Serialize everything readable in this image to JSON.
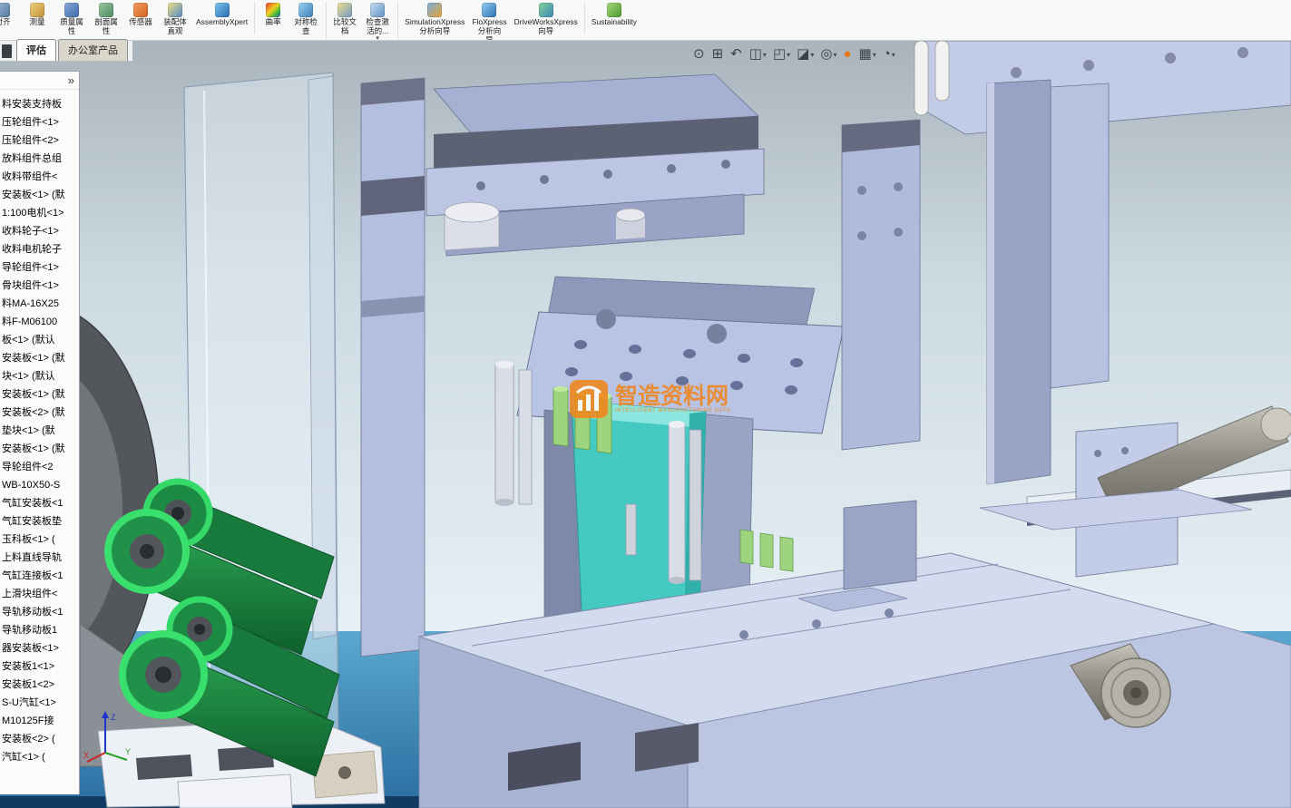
{
  "ribbon": {
    "tools": [
      {
        "label": "对齐",
        "icon_name": "align-icon",
        "icon_style": "background:linear-gradient(135deg,#9ab6d4,#54789c)"
      },
      {
        "label": "测量",
        "icon_name": "measure-icon",
        "icon_style": "background:linear-gradient(135deg,#f0d080,#c09038)"
      },
      {
        "label": "质量属\n性",
        "icon_name": "mass-properties-icon",
        "icon_style": "background:linear-gradient(135deg,#88aad8,#3c68a8)"
      },
      {
        "label": "剖面属\n性",
        "icon_name": "section-properties-icon",
        "icon_style": "background:linear-gradient(135deg,#9cc8a0,#4a8860)"
      },
      {
        "label": "传感器",
        "icon_name": "sensor-icon",
        "icon_style": "background:linear-gradient(135deg,#f0a060,#d06020)"
      },
      {
        "label": "装配体\n直观",
        "icon_name": "assembly-visualization-icon",
        "icon_style": "background:linear-gradient(135deg,#f0e080,#5088c8)"
      },
      {
        "label": "AssemblyXpert",
        "icon_name": "assemblyxpert-icon",
        "icon_style": "background:linear-gradient(135deg,#80c8f0,#2868b0)"
      },
      {
        "label": "曲率",
        "group_start": "1",
        "icon_name": "curvature-icon",
        "icon_style": "background:linear-gradient(135deg,#e03838,#f0d020 45%,#38b838 75%,#3858d8)"
      },
      {
        "label": "对称检\n查",
        "icon_name": "symmetry-check-icon",
        "icon_style": "background:linear-gradient(135deg,#a0d0f0,#3880b8)"
      },
      {
        "label": "比较文\n档",
        "group_start": "1",
        "icon_name": "compare-documents-icon",
        "icon_style": "background:linear-gradient(135deg,#f0e090,#7098c0)"
      },
      {
        "label": "检查激\n活的...",
        "dropdown": "▾",
        "icon_name": "check-active-document-icon",
        "icon_style": "background:linear-gradient(135deg,#c8dff0,#6090c0)"
      },
      {
        "label": "SimulationXpress\n分析向导",
        "group_start": "1",
        "icon_name": "simulationxpress-icon",
        "icon_style": "background:linear-gradient(135deg,#78b0e0,#e8a030)"
      },
      {
        "label": "FloXpress\n分析向\n导",
        "icon_name": "floxpress-icon",
        "icon_style": "background:linear-gradient(135deg,#90d0f0,#3070b0)"
      },
      {
        "label": "DriveWorksXpress\n向导",
        "icon_name": "driveworksxpress-icon",
        "icon_style": "background:linear-gradient(135deg,#88d098,#3888b8)"
      },
      {
        "label": "Sustainability",
        "group_start": "1",
        "icon_name": "sustainability-icon",
        "icon_style": "background:linear-gradient(135deg,#a8d878,#48982f)"
      }
    ]
  },
  "tabs": {
    "items": [
      {
        "label": "评估",
        "state": "active"
      },
      {
        "label": "办公室产品",
        "state": "normal"
      }
    ]
  },
  "feature_tree": {
    "collapse_glyph": "»",
    "items": [
      {
        "label": "料安装支持板"
      },
      {
        "label": "压轮组件<1>"
      },
      {
        "label": "压轮组件<2>"
      },
      {
        "label": "放料组件总组"
      },
      {
        "label": "收料带组件<"
      },
      {
        "label": "安装板<1> (默"
      },
      {
        "label": "1:100电机<1>"
      },
      {
        "label": "收料轮子<1>"
      },
      {
        "label": "收料电机轮子"
      },
      {
        "label": "导轮组件<1>"
      },
      {
        "label": "骨块组件<1>"
      },
      {
        "label": "料MA-16X25"
      },
      {
        "label": "料F-M06100"
      },
      {
        "label": "板<1> (默认"
      },
      {
        "label": "安装板<1> (默"
      },
      {
        "label": "块<1> (默认"
      },
      {
        "label": "安装板<1> (默"
      },
      {
        "label": "安装板<2> (默"
      },
      {
        "label": "垫块<1> (默"
      },
      {
        "label": "安装板<1> (默"
      },
      {
        "label": "导轮组件<2"
      },
      {
        "label": "WB-10X50-S"
      },
      {
        "label": "气缸安装板<1"
      },
      {
        "label": "气缸安装板垫"
      },
      {
        "label": "玉科板<1> ("
      },
      {
        "label": "上料直线导轨"
      },
      {
        "label": "气缸连接板<1"
      },
      {
        "label": "上滑块组件<"
      },
      {
        "label": "导轨移动板<1"
      },
      {
        "label": "导轨移动板1"
      },
      {
        "label": "器安装板<1>"
      },
      {
        "label": "安装板1<1>"
      },
      {
        "label": "安装板1<2>"
      },
      {
        "label": "S-U汽缸<1>"
      },
      {
        "label": "M10125F接"
      },
      {
        "label": "安装板<2> ("
      },
      {
        "label": "汽缸<1> ("
      }
    ]
  },
  "viewport_toolbar": {
    "buttons": [
      {
        "name": "zoom-fit-button",
        "icon": "zoom-fit-icon",
        "glyph": "⊙",
        "dropdown": ""
      },
      {
        "name": "zoom-area-button",
        "icon": "zoom-area-icon",
        "glyph": "⊞",
        "dropdown": ""
      },
      {
        "name": "previous-view-button",
        "icon": "previous-view-icon",
        "glyph": "↶",
        "dropdown": ""
      },
      {
        "name": "section-view-button",
        "icon": "section-view-icon",
        "glyph": "◫",
        "dropdown": "▾"
      },
      {
        "name": "view-orientation-button",
        "icon": "view-orientation-cube-icon",
        "glyph": "◰",
        "dropdown": "▾"
      },
      {
        "name": "display-style-button",
        "icon": "display-style-icon",
        "glyph": "◪",
        "dropdown": "▾"
      },
      {
        "name": "hide-show-items-button",
        "icon": "hide-show-items-icon",
        "glyph": "◎",
        "dropdown": "▾"
      },
      {
        "name": "edit-appearance-button",
        "icon": "edit-appearance-ball-icon",
        "glyph": "●",
        "style": "color:#e07818",
        "dropdown": ""
      },
      {
        "name": "apply-scene-button",
        "icon": "apply-scene-icon",
        "glyph": "▦",
        "dropdown": "▾"
      },
      {
        "name": "view-settings-button",
        "icon": "view-settings-icon",
        "glyph": "◔",
        "dropdown": "▾"
      }
    ]
  },
  "watermark": {
    "title": "智造资料网",
    "subtitle": "INTELLIGENT MANUFACTURING DATA"
  },
  "triad": {
    "x": "X",
    "y": "Y",
    "z": "Z"
  },
  "scene": {
    "colors": {
      "sky_top": "#a9b4bc",
      "sky_mid": "#cdd9e1",
      "sky_bottom": "#e6f1f6",
      "water": "#4a97c4",
      "water_deep": "#23639a",
      "bottom_strip": "#113a62",
      "part_light": "#d3dbee",
      "part_mid": "#b2bcdc",
      "part_dark": "#8d97ba",
      "roller_green": "#1f9148",
      "roller_ring": "#3ae06e",
      "teal_part": "#44cac3",
      "pin_green": "#9ed47f",
      "metal_gray": "#a8a59e",
      "disc_gray": "#53575b",
      "watermark_orange": "#f0861c"
    }
  }
}
